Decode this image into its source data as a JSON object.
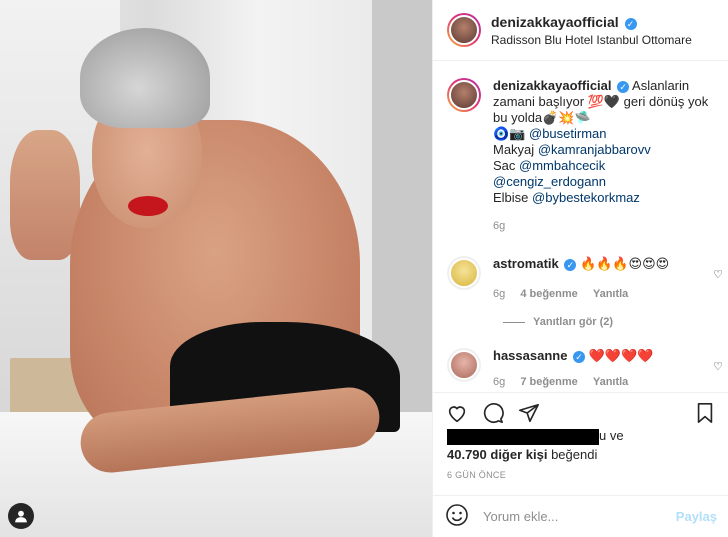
{
  "post": {
    "username": "denizakkayaofficial",
    "location": "Radisson Blu Hotel Istanbul Ottomare",
    "photo_tag_icon": "user-tag-icon"
  },
  "caption": {
    "username": "denizakkayaofficial",
    "line1": "Aslanlarin",
    "line2a": "zamani başlıyor",
    "line2b": "geri dönüş yok",
    "line3a": "bu yolda",
    "mention1": "@busetirman",
    "line5_label": "Makyaj",
    "mention2": "@kamranjabbarovv",
    "line6_label": "Sac",
    "mention3": "@mmbahcecik",
    "mention4": "@cengiz_erdogann",
    "line8_label": "Elbise",
    "mention5": "@bybestekorkmaz",
    "time": "6g"
  },
  "comments": [
    {
      "username": "astromatik",
      "text": "🔥🔥🔥😍😍😍",
      "time": "6g",
      "likes": "4 beğenme",
      "reply": "Yanıtla"
    },
    {
      "username": "hassasanne",
      "text": "❤️❤️❤️❤️",
      "time": "6g",
      "likes": "7 beğenme",
      "reply": "Yanıtla"
    }
  ],
  "view_replies": "Yanıtları gör (2)",
  "likes": {
    "suffix": "u ve",
    "count_text": "40.790 diğer kişi",
    "liked_text": "beğendi"
  },
  "age": "6 GÜN ÖNCE",
  "add_comment": {
    "placeholder": "Yorum ekle...",
    "post_label": "Paylaş"
  },
  "colors": {
    "verified": "#3897f0",
    "mention": "#00376b",
    "muted": "#8e8e8e",
    "post_disabled": "#b2dffc"
  }
}
